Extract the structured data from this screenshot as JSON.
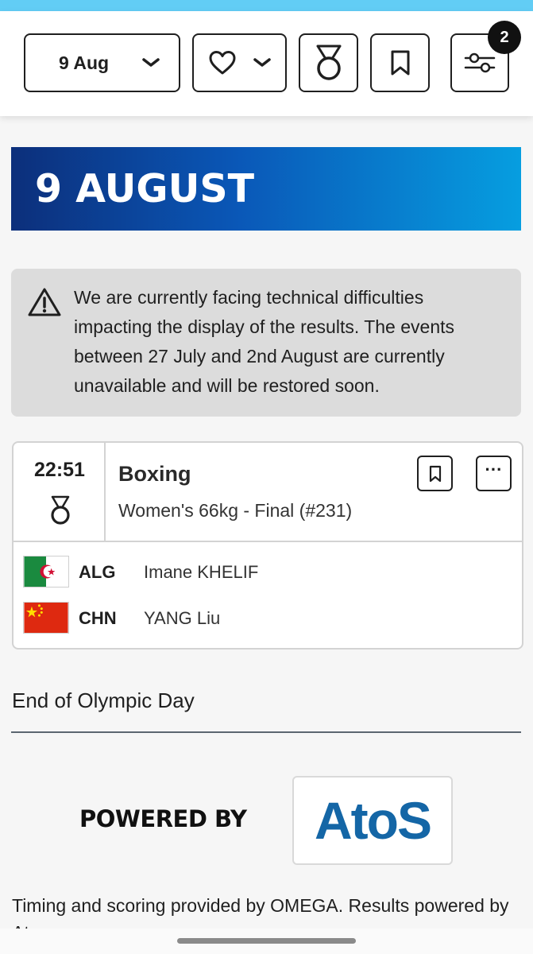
{
  "toolbar": {
    "date_label": "9 Aug",
    "filter_badge": "2"
  },
  "day_banner": {
    "title": "9 AUGUST"
  },
  "alert": {
    "text": "We are currently facing technical difficulties impacting the display of the results. The events between 27 July and 2nd August are currently unavailable and will be restored soon."
  },
  "event": {
    "time": "22:51",
    "sport": "Boxing",
    "name": "Women's 66kg - Final (#231)",
    "more_label": "···",
    "competitors": [
      {
        "noc": "ALG",
        "athlete": "Imane KHELIF",
        "flag_icon": "algeria-flag-icon"
      },
      {
        "noc": "CHN",
        "athlete": "YANG Liu",
        "flag_icon": "china-flag-icon"
      }
    ]
  },
  "end_of_day": "End of Olympic Day",
  "sponsor": {
    "powered_by": "POWERED BY",
    "logo": "AtoS"
  },
  "footer": {
    "text": "Timing and scoring provided by OMEGA. Results powered by Atos."
  },
  "colors": {
    "top_accent": "#62cdf5",
    "banner_start": "#0c2f7b",
    "banner_end": "#069ee0",
    "atos_blue": "#1466a6"
  }
}
